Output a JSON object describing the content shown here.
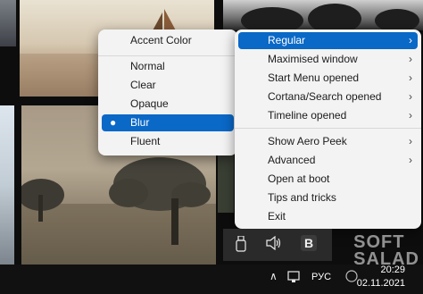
{
  "menu_left": {
    "header": "Accent Color",
    "items": [
      {
        "label": "Normal"
      },
      {
        "label": "Clear"
      },
      {
        "label": "Opaque"
      },
      {
        "label": "Blur",
        "selected": true,
        "bullet": "●"
      },
      {
        "label": "Fluent"
      }
    ]
  },
  "menu_right": {
    "items": [
      {
        "label": "Regular",
        "chevron": "›",
        "selected": true
      },
      {
        "label": "Maximised window",
        "chevron": "›"
      },
      {
        "label": "Start Menu opened",
        "chevron": "›"
      },
      {
        "label": "Cortana/Search opened",
        "chevron": "›"
      },
      {
        "label": "Timeline opened",
        "chevron": "›"
      },
      {
        "label": "Show Aero Peek",
        "chevron": "›"
      },
      {
        "label": "Advanced",
        "chevron": "›"
      },
      {
        "label": "Open at boot"
      },
      {
        "label": "Tips and tricks"
      },
      {
        "label": "Exit"
      }
    ]
  },
  "taskbar": {
    "chevron_up": "∧",
    "language": "РУС",
    "time": "20:29",
    "date": "02.11.2021"
  },
  "watermark": {
    "line1": "SOFT",
    "line2": "SALAD"
  },
  "colors": {
    "accent": "#0a68c7",
    "menu_bg": "#f3f3f3",
    "taskbar_bg": "#121212"
  },
  "icons": [
    "usb-eject-icon",
    "volume-icon",
    "translucenttb-icon",
    "network-icon",
    "tray-overflow-icon"
  ]
}
